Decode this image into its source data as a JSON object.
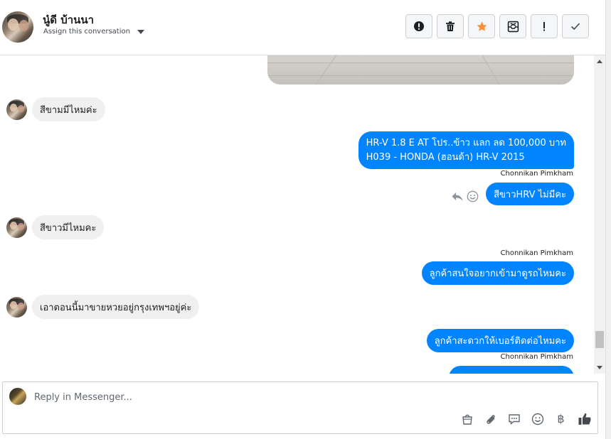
{
  "header": {
    "contact_name": "นู๋ดี บ้านนา",
    "assign_label": "Assign this conversation"
  },
  "toolbar": [
    {
      "name": "mark-spam-button",
      "icon": "alert-circle-icon"
    },
    {
      "name": "delete-button",
      "icon": "trash-icon"
    },
    {
      "name": "star-button",
      "icon": "star-icon"
    },
    {
      "name": "archive-button",
      "icon": "archive-icon"
    },
    {
      "name": "follow-up-button",
      "icon": "exclamation-icon"
    },
    {
      "name": "done-button",
      "icon": "checkmark-icon"
    }
  ],
  "messages": {
    "in_1": "สีขามมีไหมค่ะ",
    "out_1_line1": "HR-V 1.8 E AT โปร..ข้าว แลก ลด 100,000 บาท",
    "out_1_line2": "H039 - HONDA (ฮอนด้า) HR-V 2015",
    "sender_1": "Chonnikan Pimkham",
    "out_2": "สีขาวHRV ไม่มีคะ",
    "in_2": "สีขาวมีไหมคะ",
    "sender_2": "Chonnikan Pimkham",
    "out_3": "ลูกค้าสนใจอยากเข้ามาดูรถไหมคะ",
    "in_3": "เอาตอนนี้มาขายหวยอยู่กรุงเทพฯอยู่ค่ะ",
    "out_4": "ลูกค้าสะดวกให้เบอร์ติดต่อไหมคะ",
    "sender_3": "Chonnikan Pimkham"
  },
  "composer": {
    "placeholder": "Reply in Messenger...",
    "currency_symbol": "฿"
  },
  "colors": {
    "accent": "#0084ff",
    "incoming_bubble": "#f1f0f0",
    "star": "#f7923b"
  }
}
